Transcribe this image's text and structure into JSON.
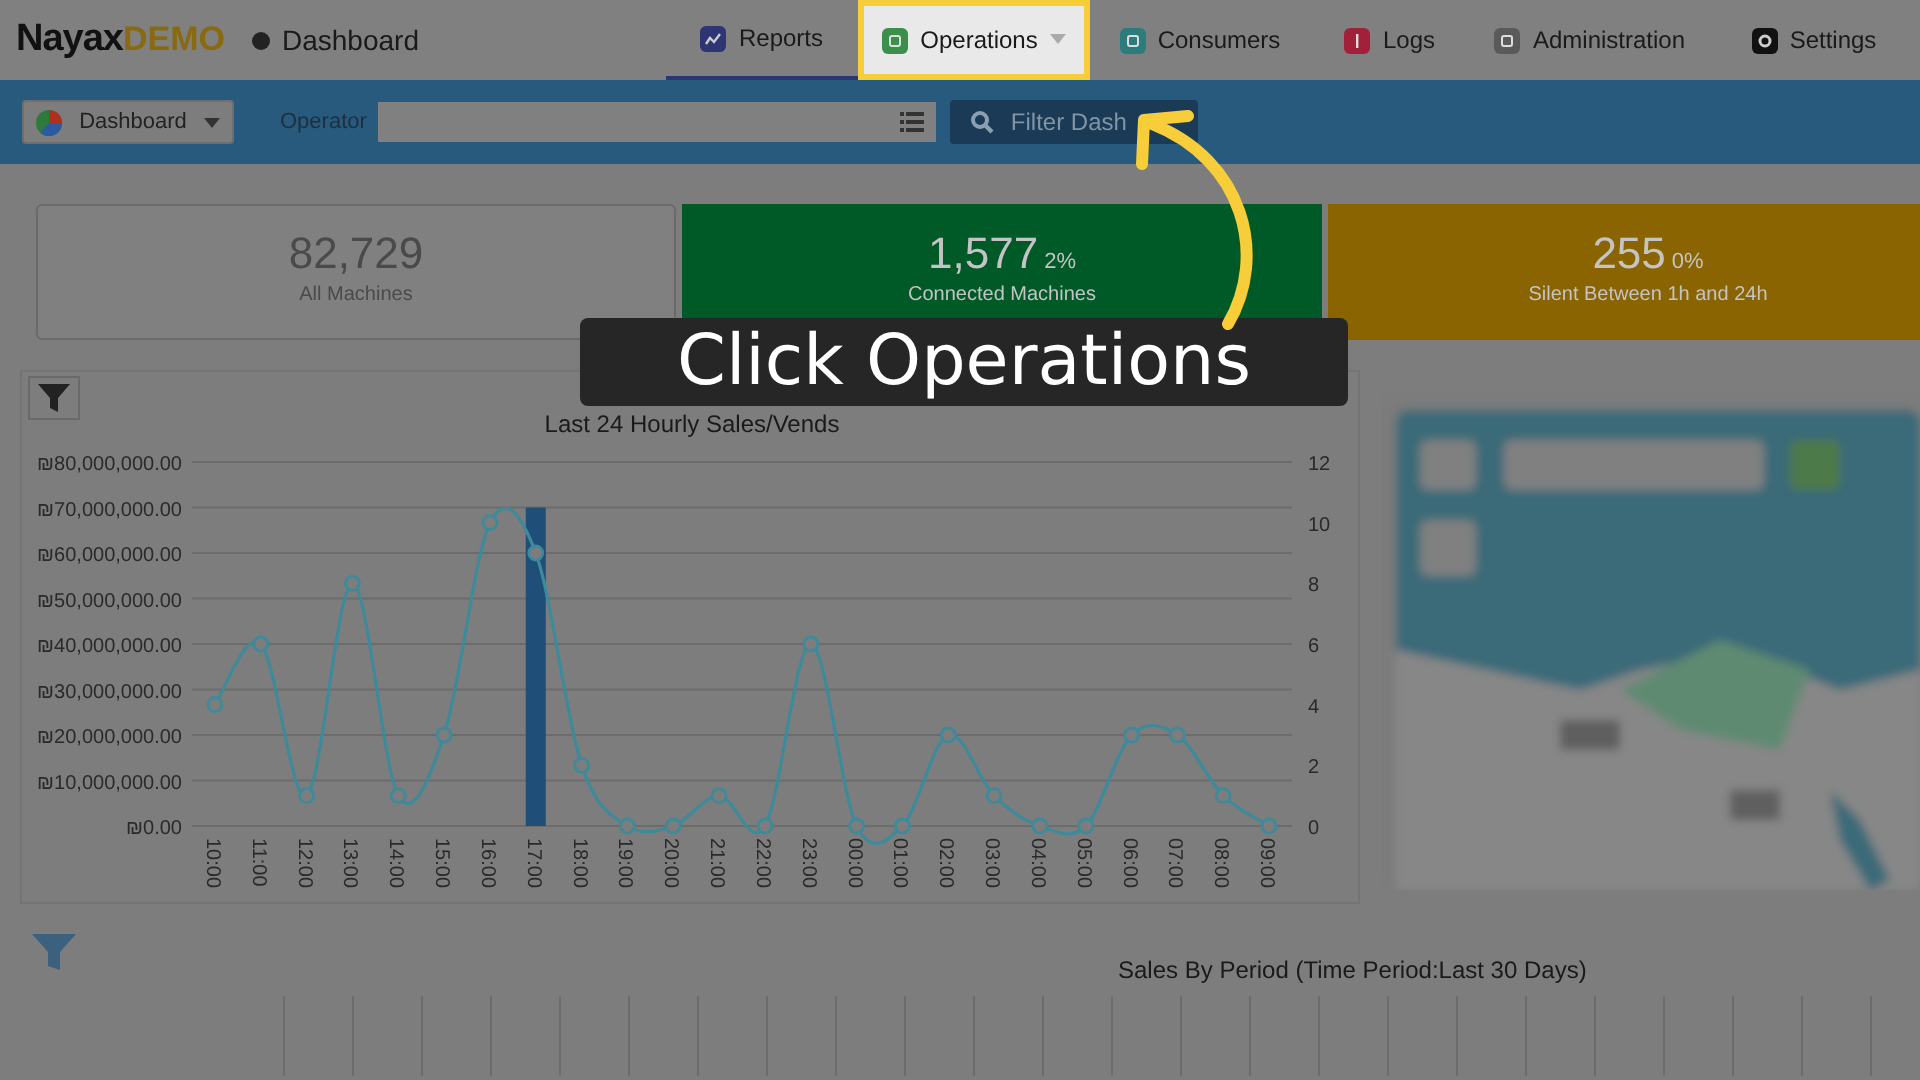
{
  "header": {
    "logo": {
      "name": "Nayax",
      "suffix": "DEMO"
    },
    "page_title": "Dashboard",
    "nav": [
      {
        "label": "Reports",
        "kind": "reports",
        "selected": true,
        "highlighted": false,
        "has_menu": false
      },
      {
        "label": "Operations",
        "kind": "operations",
        "selected": false,
        "highlighted": true,
        "has_menu": true
      },
      {
        "label": "Consumers",
        "kind": "consumers",
        "selected": false,
        "highlighted": false,
        "has_menu": false
      },
      {
        "label": "Logs",
        "kind": "logs",
        "selected": false,
        "highlighted": false,
        "has_menu": false
      },
      {
        "label": "Administration",
        "kind": "administration",
        "selected": false,
        "highlighted": false,
        "has_menu": false
      },
      {
        "label": "Settings",
        "kind": "settings",
        "selected": false,
        "highlighted": false,
        "has_menu": false
      }
    ]
  },
  "toolbar": {
    "view_button": "Dashboard",
    "operator_label": "Operator",
    "filter_button": "Filter Dash"
  },
  "stats": [
    {
      "value": "82,729",
      "label": "All Machines",
      "color": "#808080"
    },
    {
      "value": "1,577",
      "percent": "2%",
      "label": "Connected Machines",
      "color": "#005a28"
    },
    {
      "value": "255",
      "percent": "0%",
      "label": "Silent Between 1h and 24h",
      "color": "#8a6400"
    }
  ],
  "hourly_chart": {
    "chart_data": {
      "type": "bar",
      "title": "Last 24 Hourly Sales/Vends",
      "categories": [
        "10:00",
        "11:00",
        "12:00",
        "13:00",
        "14:00",
        "15:00",
        "16:00",
        "17:00",
        "18:00",
        "19:00",
        "20:00",
        "21:00",
        "22:00",
        "23:00",
        "00:00",
        "01:00",
        "02:00",
        "03:00",
        "04:00",
        "05:00",
        "06:00",
        "07:00",
        "08:00",
        "09:00"
      ],
      "series": [
        {
          "color": "#1f4e79",
          "values": [
            0,
            0,
            0,
            0,
            0,
            0,
            0,
            70000000,
            0,
            0,
            0,
            0,
            0,
            0,
            0,
            0,
            0,
            0,
            0,
            0,
            0,
            0,
            0,
            0
          ]
        },
        {
          "type": "line",
          "axis": "y2",
          "marker": "o",
          "color": "#3d8a9a",
          "values": [
            4,
            6,
            1,
            8,
            1,
            3,
            10,
            9,
            2,
            0,
            0,
            1,
            0,
            6,
            0,
            0,
            3,
            1,
            0,
            0,
            3,
            3,
            1,
            0
          ]
        }
      ],
      "grid": true,
      "ylim": [
        0,
        80000000
      ],
      "yticks": [
        {
          "value": 0,
          "label": "₪0.00"
        },
        {
          "value": 10000000,
          "label": "₪10,000,000.00"
        },
        {
          "value": 20000000,
          "label": "₪20,000,000.00"
        },
        {
          "value": 30000000,
          "label": "₪30,000,000.00"
        },
        {
          "value": 40000000,
          "label": "₪40,000,000.00"
        },
        {
          "value": 50000000,
          "label": "₪50,000,000.00"
        },
        {
          "value": 60000000,
          "label": "₪60,000,000.00"
        },
        {
          "value": 70000000,
          "label": "₪70,000,000.00"
        },
        {
          "value": 80000000,
          "label": "₪80,000,000.00"
        }
      ],
      "y2lim": [
        0,
        12
      ],
      "y2ticks": [
        0,
        2,
        4,
        6,
        8,
        10,
        12
      ]
    }
  },
  "period_chart": {
    "title": "Sales By Period (Time Period:Last 30 Days)"
  },
  "tutorial": {
    "caption": "Click Operations"
  }
}
